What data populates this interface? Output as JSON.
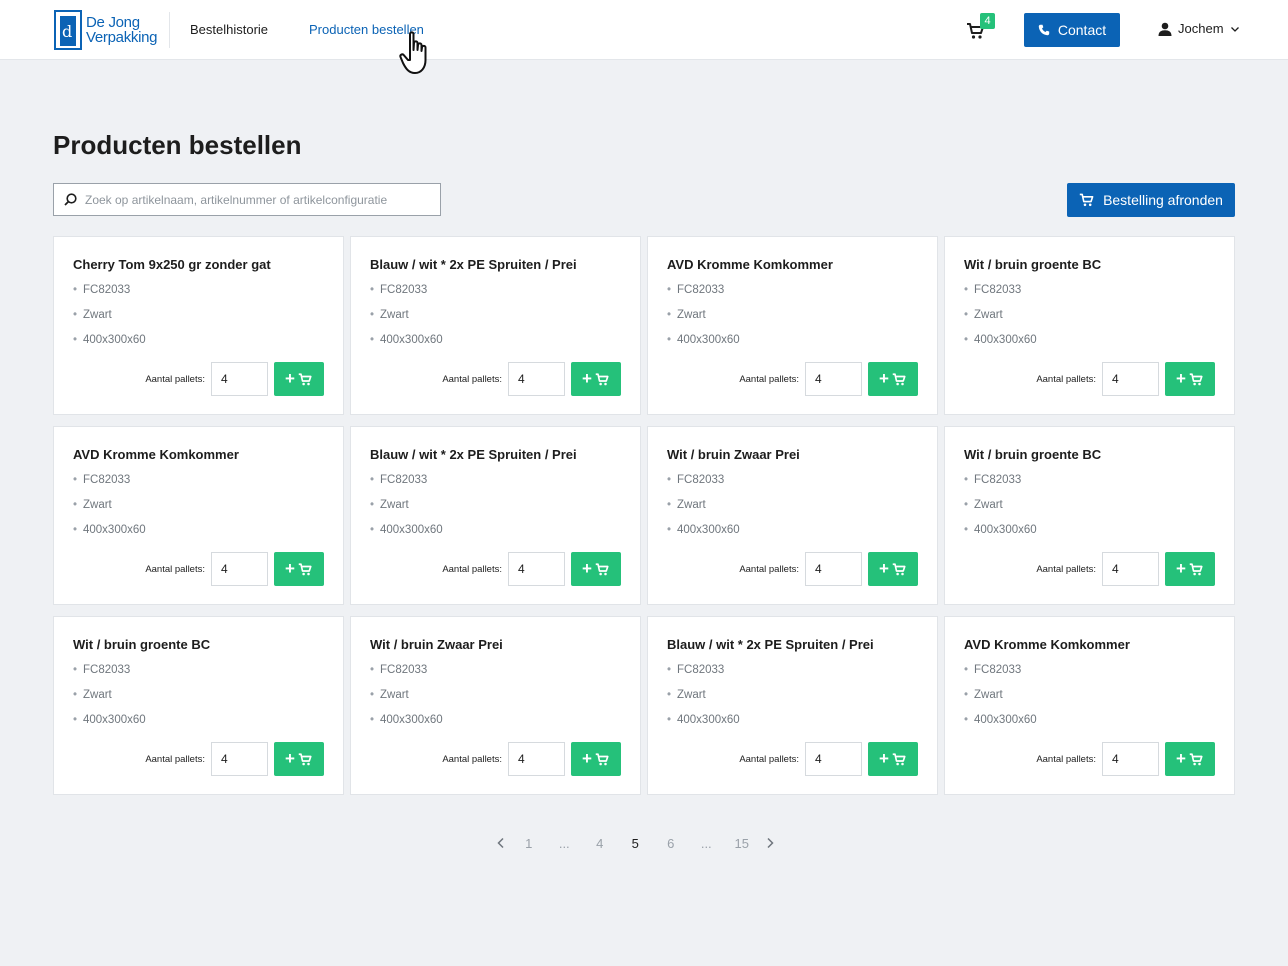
{
  "brand": {
    "line1": "De Jong",
    "line2": "Verpakking"
  },
  "nav": [
    {
      "label": "Bestelhistorie"
    },
    {
      "label": "Producten bestellen"
    }
  ],
  "cart": {
    "count": "4"
  },
  "contact": {
    "label": "Contact"
  },
  "user": {
    "name": "Jochem"
  },
  "page": {
    "title": "Producten bestellen"
  },
  "search": {
    "placeholder": "Zoek op artikelnaam, artikelnummer of artikelconfiguratie",
    "value": ""
  },
  "checkout": {
    "label": "Bestelling afronden"
  },
  "qty_label": "Aantal pallets:",
  "products": [
    {
      "title": "Cherry Tom 9x250 gr zonder gat",
      "code": "FC82033",
      "color": "Zwart",
      "size": "400x300x60",
      "qty": "4"
    },
    {
      "title": "Blauw / wit * 2x PE Spruiten / Prei",
      "code": "FC82033",
      "color": "Zwart",
      "size": "400x300x60",
      "qty": "4"
    },
    {
      "title": "AVD Kromme Komkommer",
      "code": "FC82033",
      "color": "Zwart",
      "size": "400x300x60",
      "qty": "4"
    },
    {
      "title": "Wit / bruin groente BC",
      "code": "FC82033",
      "color": "Zwart",
      "size": "400x300x60",
      "qty": "4"
    },
    {
      "title": "AVD Kromme Komkommer",
      "code": "FC82033",
      "color": "Zwart",
      "size": "400x300x60",
      "qty": "4"
    },
    {
      "title": "Blauw / wit * 2x PE Spruiten / Prei",
      "code": "FC82033",
      "color": "Zwart",
      "size": "400x300x60",
      "qty": "4"
    },
    {
      "title": "Wit / bruin Zwaar Prei",
      "code": "FC82033",
      "color": "Zwart",
      "size": "400x300x60",
      "qty": "4"
    },
    {
      "title": "Wit / bruin groente BC",
      "code": "FC82033",
      "color": "Zwart",
      "size": "400x300x60",
      "qty": "4"
    },
    {
      "title": "Wit / bruin groente BC",
      "code": "FC82033",
      "color": "Zwart",
      "size": "400x300x60",
      "qty": "4"
    },
    {
      "title": "Wit / bruin Zwaar Prei",
      "code": "FC82033",
      "color": "Zwart",
      "size": "400x300x60",
      "qty": "4"
    },
    {
      "title": "Blauw / wit * 2x PE Spruiten / Prei",
      "code": "FC82033",
      "color": "Zwart",
      "size": "400x300x60",
      "qty": "4"
    },
    {
      "title": "AVD Kromme Komkommer",
      "code": "FC82033",
      "color": "Zwart",
      "size": "400x300x60",
      "qty": "4"
    }
  ],
  "pagination": {
    "items": [
      "1",
      "...",
      "4",
      "5",
      "6",
      "...",
      "15"
    ],
    "current": "5"
  },
  "colors": {
    "primary": "#0b63b5",
    "success": "#25c17a",
    "background": "#eff1f4"
  },
  "icons": [
    "cart-icon",
    "phone-icon",
    "user-icon",
    "chevron-down-icon",
    "search-icon",
    "add-to-cart-icon",
    "chevron-left-icon",
    "chevron-right-icon",
    "hand-pointer-icon"
  ]
}
